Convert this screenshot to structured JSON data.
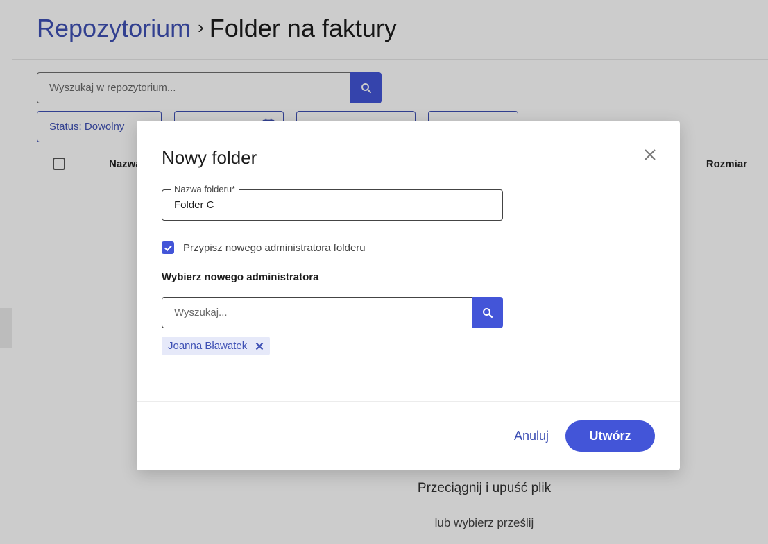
{
  "breadcrumb": {
    "root": "Repozytorium",
    "separator": "›",
    "current": "Folder na faktury"
  },
  "repo_search": {
    "placeholder": "Wyszukaj w repozytorium...",
    "icon": "search-icon"
  },
  "filters": {
    "status": "Status: Dowolny",
    "date_icon": "calendar-icon"
  },
  "table": {
    "headers": {
      "name": "Nazwa",
      "size": "Rozmiar"
    }
  },
  "dropzone": {
    "title": "Przeciągnij i upuść plik",
    "subtitle": "lub wybierz prześlij"
  },
  "dialog": {
    "title": "Nowy folder",
    "close_icon": "close-icon",
    "folder_name": {
      "label": "Nazwa folderu*",
      "value": "Folder C"
    },
    "assign_admin": {
      "checked": true,
      "label": "Przypisz nowego administratora folderu"
    },
    "admin_section_label": "Wybierz nowego administratora",
    "admin_search": {
      "placeholder": "Wyszukaj..."
    },
    "selected_admins": [
      {
        "name": "Joanna Bławatek"
      }
    ],
    "buttons": {
      "cancel": "Anuluj",
      "create": "Utwórz"
    }
  },
  "colors": {
    "accent": "#4355d8",
    "link": "#3f51b5",
    "chip_bg": "#e6e9f9"
  }
}
